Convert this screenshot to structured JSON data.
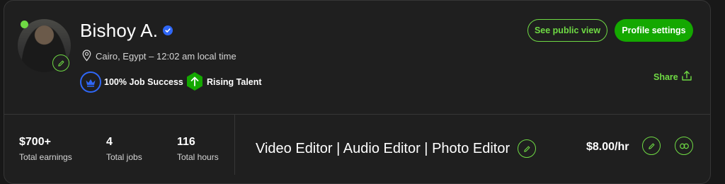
{
  "profile": {
    "name": "Bishoy A.",
    "location": "Cairo, Egypt – 12:02 am local time",
    "badges": [
      {
        "label": "100% Job Success",
        "icon": "crown-icon"
      },
      {
        "label": "Rising Talent",
        "icon": "rising-talent-icon"
      }
    ],
    "online": true
  },
  "actions": {
    "see_public_view": "See public view",
    "profile_settings": "Profile settings",
    "share": "Share"
  },
  "stats": [
    {
      "value": "$700+",
      "label": "Total earnings"
    },
    {
      "value": "4",
      "label": "Total jobs"
    },
    {
      "value": "116",
      "label": "Total hours"
    }
  ],
  "headline": "Video Editor | Audio Editor | Photo Editor",
  "rate": "$8.00/hr",
  "colors": {
    "accent": "#6fda44",
    "primary_button": "#14a800",
    "verified": "#2f67f6",
    "background": "#1f1f1f"
  }
}
